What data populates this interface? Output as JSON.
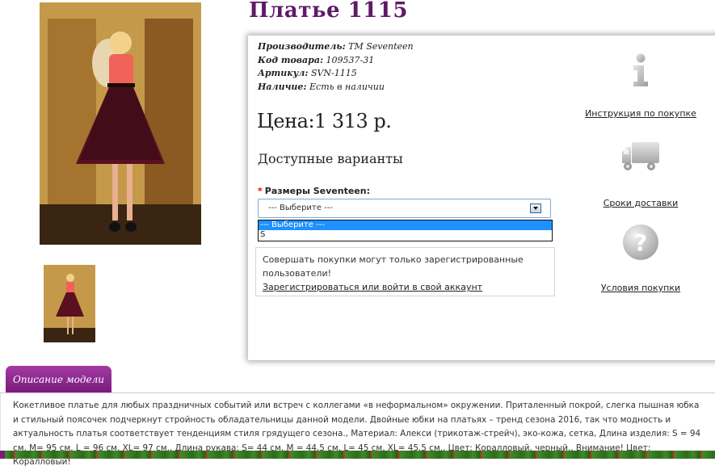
{
  "product": {
    "title": "Платье 1115",
    "main_image_alt": "",
    "meta": [
      {
        "label": "Производитель:",
        "value": "TM Seventeen"
      },
      {
        "label": "Код товара:",
        "value": "109537-31"
      },
      {
        "label": "Артикул:",
        "value": "SVN-1115"
      },
      {
        "label": "Наличие:",
        "value": "Есть в наличии"
      }
    ],
    "price": "Цена:1 313 р."
  },
  "options": {
    "heading": "Доступные варианты",
    "size_label": "Размеры Seventeen:",
    "required_mark": "*",
    "selected": "--- Выберите ---",
    "dropdown": [
      "--- Выберите ---",
      "S"
    ]
  },
  "notice": {
    "text": "Совершать покупки могут только зарегистрированные пользователи!",
    "link": "Зарегистрироваться или войти в свой аккаунт"
  },
  "side_links": [
    {
      "icon": "info-icon",
      "label": "Инструкция по покупке"
    },
    {
      "icon": "truck-icon",
      "label": "Сроки доставки"
    },
    {
      "icon": "question-icon",
      "label": "Условия покупки"
    }
  ],
  "description": {
    "tab": "Описание модели",
    "text": "Кокетливое платье для любых праздничных событий или встреч с коллегами «в неформальном» окружении. Приталенный покрой, слегка пышная юбка и стильный поясочек подчеркнут стройность обладательницы данной модели. Двойные юбки на платьях – тренд сезона 2016, так что модность и актуальность платья соответствует тенденциям стиля грядущего сезона., Материал: Алекси (трикотаж-стрейч), эко-кожа, сетка, Длина изделия: S = 94 см, M= 95 см, L = 96 см, XL= 97 см., Длина рукава: S= 44 см, M = 44,5 см, L= 45 см, XL= 45,5 см., Цвет: Коралловый, черный., Внимание! Цвет: Коралловый!"
  },
  "colors": {
    "title": "#5e1a67",
    "tab": "#7a1c7c",
    "dropdown_highlight": "#1e90ff",
    "required": "#ee0000"
  }
}
